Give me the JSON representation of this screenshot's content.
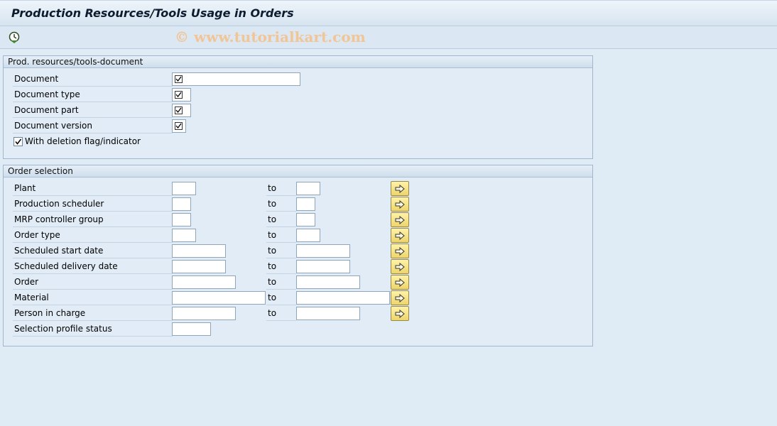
{
  "title": "Production Resources/Tools Usage in Orders",
  "toolbar": {
    "execute_icon": "execute-clock-icon"
  },
  "watermark": "© www.tutorialkart.com",
  "group_document": {
    "header": "Prod. resources/tools-document",
    "fields": [
      {
        "label": "Document",
        "value": ""
      },
      {
        "label": "Document type",
        "value": ""
      },
      {
        "label": "Document part",
        "value": ""
      },
      {
        "label": "Document version",
        "value": ""
      }
    ],
    "deletion_flag": {
      "label": "With deletion flag/indicator",
      "checked": true
    }
  },
  "group_order": {
    "header": "Order selection",
    "to_label": "to",
    "fields": [
      {
        "label": "Plant",
        "from": "",
        "to": ""
      },
      {
        "label": "Production scheduler",
        "from": "",
        "to": ""
      },
      {
        "label": "MRP controller group",
        "from": "",
        "to": ""
      },
      {
        "label": "Order type",
        "from": "",
        "to": ""
      },
      {
        "label": "Scheduled start date",
        "from": "",
        "to": ""
      },
      {
        "label": "Scheduled delivery date",
        "from": "",
        "to": ""
      },
      {
        "label": "Order",
        "from": "",
        "to": ""
      },
      {
        "label": "Material",
        "from": "",
        "to": ""
      },
      {
        "label": "Person in charge",
        "from": "",
        "to": ""
      },
      {
        "label": "Selection profile status",
        "value": ""
      }
    ]
  }
}
